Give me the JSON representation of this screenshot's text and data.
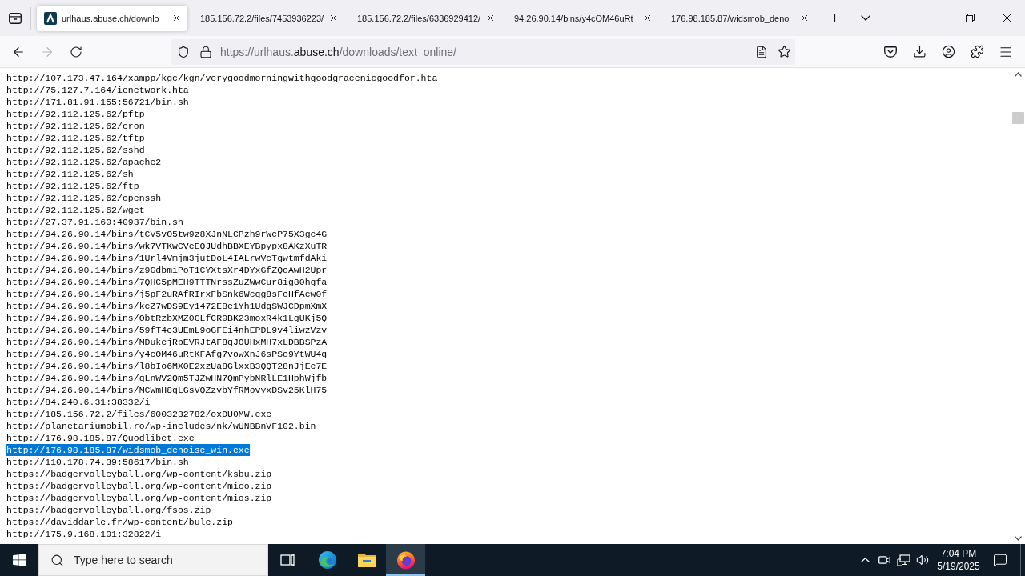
{
  "tabs": [
    {
      "title": "urlhaus.abuse.ch/downlo",
      "favicon": true,
      "selected": true
    },
    {
      "title": "185.156.72.2/files/7453936223/",
      "favicon": false,
      "selected": false
    },
    {
      "title": "185.156.72.2/files/6336929412/",
      "favicon": false,
      "selected": false
    },
    {
      "title": "94.26.90.14/bins/y4cOM46uRt",
      "favicon": false,
      "selected": false
    },
    {
      "title": "176.98.185.87/widsmob_deno",
      "favicon": false,
      "selected": false
    }
  ],
  "navigation": [
    {
      "kind": "back",
      "disabled": false
    },
    {
      "kind": "forward",
      "disabled": true
    },
    {
      "kind": "reload",
      "disabled": false
    }
  ],
  "address_bar": {
    "url_parts": [
      {
        "text": "https://urlhaus.",
        "kind": "dim"
      },
      {
        "text": "abuse.ch",
        "kind": "host"
      },
      {
        "text": "/downloads/text_online/",
        "kind": "dim"
      }
    ]
  },
  "page": {
    "lines": [
      {
        "text": "http://107.173.47.164/xampp/kgc/kgn/verygoodmorningwithgoodgracenicgoodfor.hta",
        "selected": false
      },
      {
        "text": "http://75.127.7.164/ienetwork.hta",
        "selected": false
      },
      {
        "text": "http://171.81.91.155:56721/bin.sh",
        "selected": false
      },
      {
        "text": "http://92.112.125.62/pftp",
        "selected": false
      },
      {
        "text": "http://92.112.125.62/cron",
        "selected": false
      },
      {
        "text": "http://92.112.125.62/tftp",
        "selected": false
      },
      {
        "text": "http://92.112.125.62/sshd",
        "selected": false
      },
      {
        "text": "http://92.112.125.62/apache2",
        "selected": false
      },
      {
        "text": "http://92.112.125.62/sh",
        "selected": false
      },
      {
        "text": "http://92.112.125.62/ftp",
        "selected": false
      },
      {
        "text": "http://92.112.125.62/openssh",
        "selected": false
      },
      {
        "text": "http://92.112.125.62/wget",
        "selected": false
      },
      {
        "text": "http://27.37.91.160:40937/bin.sh",
        "selected": false
      },
      {
        "text": "http://94.26.90.14/bins/tCV5vO5tw9z8XJnNLCPzh9rWcP75X3gc4G",
        "selected": false
      },
      {
        "text": "http://94.26.90.14/bins/wk7VTKwCVeEQJUdhBBXEYBpypx8AKzXuTR",
        "selected": false
      },
      {
        "text": "http://94.26.90.14/bins/1Url4Vmjm3jutDoL4IALrwVcTgwtmfdAki",
        "selected": false
      },
      {
        "text": "http://94.26.90.14/bins/z9GdbmiPoT1CYXtsXr4DYxGfZQoAwH2Upr",
        "selected": false
      },
      {
        "text": "http://94.26.90.14/bins/7QHC5pMEH9TTTNrssZuZWwCur8ig80hgfa",
        "selected": false
      },
      {
        "text": "http://94.26.90.14/bins/j5pF2uRAfRIrxFbSnk6Wcqg8sFoHfAcw0f",
        "selected": false
      },
      {
        "text": "http://94.26.90.14/bins/kcZ7wDS9Ey1472EBe1Yh1UdgSWJCDpmXmX",
        "selected": false
      },
      {
        "text": "http://94.26.90.14/bins/ObtRzbXMZ0GLfCR0BK23moxR4k1LgUKj5Q",
        "selected": false
      },
      {
        "text": "http://94.26.90.14/bins/59fT4e3UEmL9oGFEi4nhEPDL9v4liwzVzv",
        "selected": false
      },
      {
        "text": "http://94.26.90.14/bins/MDukejRpEVRJtAF8qJOUHxMH7xLDBBSPzA",
        "selected": false
      },
      {
        "text": "http://94.26.90.14/bins/y4cOM46uRtKFAfg7vowXnJ6sPSo9YtWU4q",
        "selected": false
      },
      {
        "text": "http://94.26.90.14/bins/l8bIo6MX0E2xzUa8GlxxB3QQT28nJjEe7E",
        "selected": false
      },
      {
        "text": "http://94.26.90.14/bins/qLnWV2Qm5TJZwHN7QmPybNRlLE1HphWjfb",
        "selected": false
      },
      {
        "text": "http://94.26.90.14/bins/MCWmH8qLGsVQZzvbYfRMovyxDSv25KlH75",
        "selected": false
      },
      {
        "text": "http://84.240.6.31:38332/i",
        "selected": false
      },
      {
        "text": "http://185.156.72.2/files/6003232782/oxDU0MW.exe",
        "selected": false
      },
      {
        "text": "http://planetariumobil.ro/wp-includes/nk/wUNBBnVF102.bin",
        "selected": false
      },
      {
        "text": "http://176.98.185.87/Quodlibet.exe",
        "selected": false
      },
      {
        "text": "http://176.98.185.87/widsmob_denoise_win.exe",
        "selected": true
      },
      {
        "text": "http://110.178.74.39:58617/bin.sh",
        "selected": false
      },
      {
        "text": "https://badgervolleyball.org/wp-content/ksbu.zip",
        "selected": false
      },
      {
        "text": "https://badgervolleyball.org/wp-content/mico.zip",
        "selected": false
      },
      {
        "text": "https://badgervolleyball.org/wp-content/mios.zip",
        "selected": false
      },
      {
        "text": "https://badgervolleyball.org/fsos.zip",
        "selected": false
      },
      {
        "text": "https://daviddarle.fr/wp-content/bule.zip",
        "selected": false
      },
      {
        "text": "http://175.9.168.101:32822/i",
        "selected": false
      }
    ]
  },
  "taskbar": {
    "search": {
      "placeholder": "Type here to search"
    },
    "apps": [
      {
        "kind": "task-view",
        "active": false
      },
      {
        "kind": "edge",
        "active": false
      },
      {
        "kind": "explorer",
        "active": false
      },
      {
        "kind": "firefox",
        "active": true
      }
    ],
    "clock": {
      "time": "7:04 PM",
      "date": "5/19/2025"
    }
  }
}
